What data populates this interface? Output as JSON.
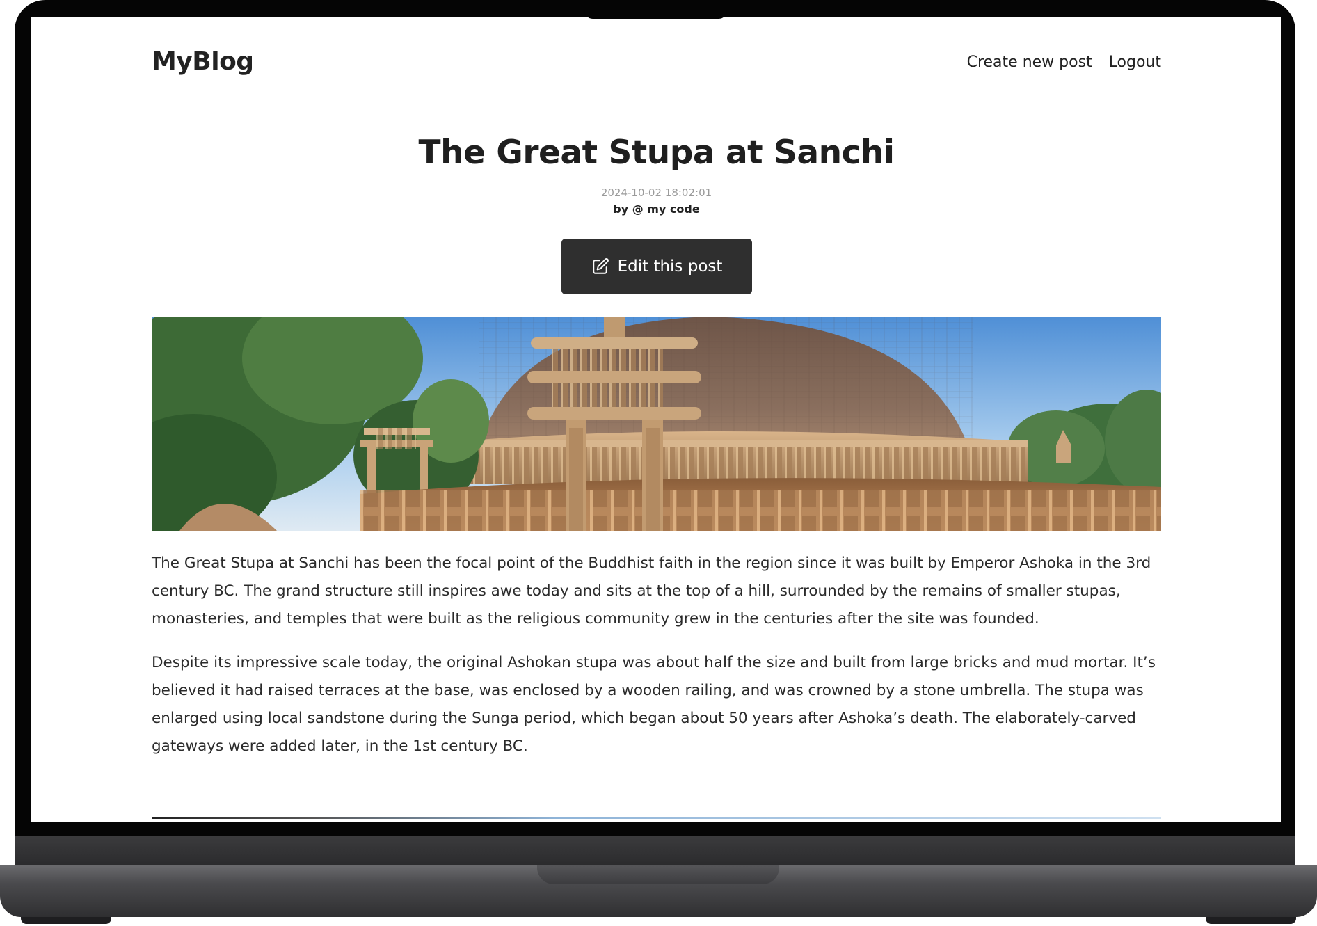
{
  "navbar": {
    "brand": "MyBlog",
    "links": [
      "Create new post",
      "Logout"
    ]
  },
  "post": {
    "title": "The Great Stupa at Sanchi",
    "date": "2024-10-02 18:02:01",
    "author": "by @ my code",
    "edit_label": "Edit this post",
    "edit_icon": "pencil-square-icon",
    "paragraphs": [
      "The Great Stupa at Sanchi has been the focal point of the Buddhist faith in the region since it was built by Emperor Ashoka in the 3rd century BC. The grand structure still inspires awe today and sits at the top of a hill, surrounded by the remains of smaller stupas, monasteries, and temples that were built as the religious community grew in the centuries after the site was founded.",
      "Despite its impressive scale today, the original Ashokan stupa was about half the size and built from large bricks and mud mortar. It’s believed it had raised terraces at the base, was enclosed by a wooden railing, and was crowned by a stone umbrella. The stupa was enlarged using local sandstone during the Sunga period, which began about 50 years after Ashoka’s death. The elaborately-carved gateways were added later, in the 1st century BC."
    ]
  },
  "colors": {
    "button_bg": "#2f2f2f",
    "text": "#222222",
    "date": "#9a9a9a"
  }
}
